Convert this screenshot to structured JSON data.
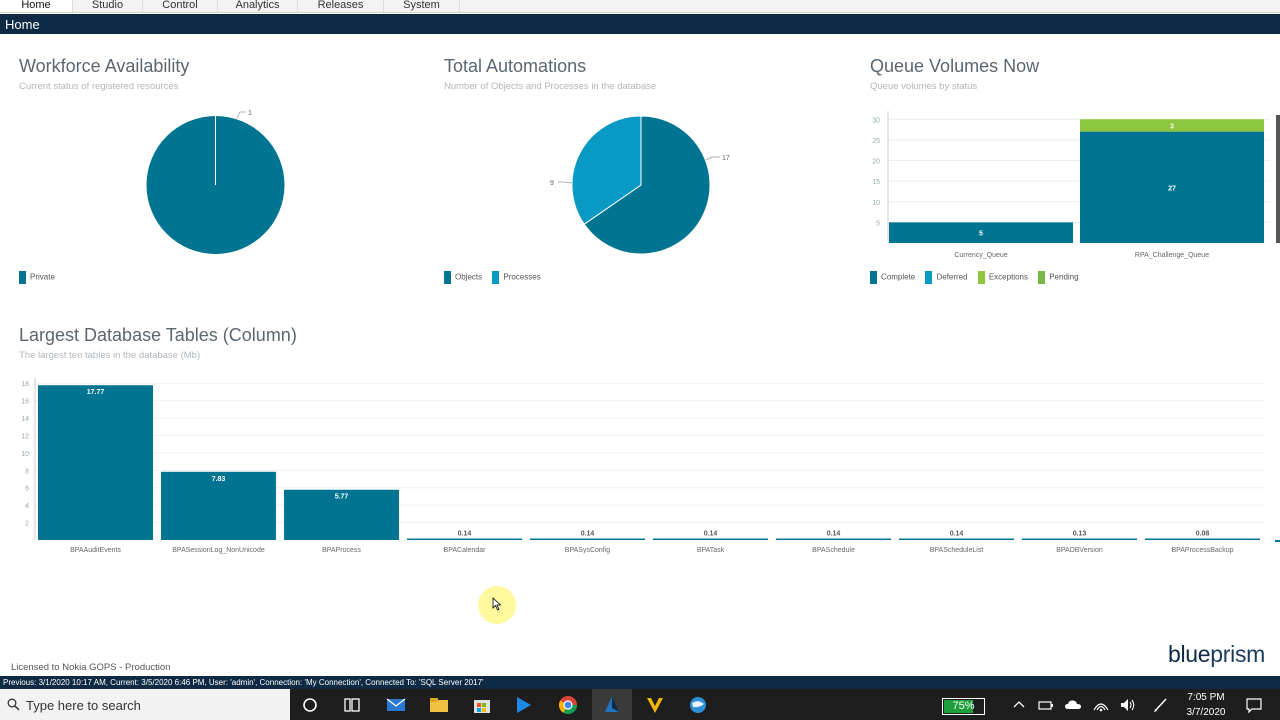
{
  "tabs": [
    {
      "label": "Home",
      "active": true
    },
    {
      "label": "Studio",
      "active": false
    },
    {
      "label": "Control",
      "active": false
    },
    {
      "label": "Analytics",
      "active": false
    },
    {
      "label": "Releases",
      "active": false
    },
    {
      "label": "System",
      "active": false
    }
  ],
  "header": {
    "title": "Home"
  },
  "colors": {
    "primary": "#007490",
    "light_blue": "#0899c5",
    "green": "#8dc63f",
    "header": "#0f2a44"
  },
  "panels": {
    "workforce": {
      "title": "Workforce Availability",
      "subtitle": "Current status of registered resources",
      "legend": [
        "Private"
      ]
    },
    "automations": {
      "title": "Total Automations",
      "subtitle": "Number of Objects and Processes in the database",
      "legend": [
        "Objects",
        "Processes"
      ]
    },
    "queues": {
      "title": "Queue Volumes Now",
      "subtitle": "Queue volumes by status",
      "legend": [
        "Complete",
        "Deferred",
        "Exceptions",
        "Pending"
      ]
    },
    "tables": {
      "title": "Largest Database Tables (Column)",
      "subtitle": "The largest ten tables in the database (Mb)"
    }
  },
  "chart_data": [
    {
      "type": "pie",
      "title": "Workforce Availability",
      "categories": [
        "Private"
      ],
      "values": [
        1
      ],
      "data_labels": [
        "1"
      ]
    },
    {
      "type": "pie",
      "title": "Total Automations",
      "categories": [
        "Objects",
        "Processes"
      ],
      "values": [
        17,
        9
      ],
      "data_labels": [
        "17",
        "9"
      ]
    },
    {
      "type": "bar",
      "title": "Queue Volumes Now",
      "stacked": true,
      "categories": [
        "Currency_Queue",
        "RPA_Challenge_Queue"
      ],
      "series": [
        {
          "name": "Complete",
          "values": [
            5,
            27
          ],
          "color": "#007490"
        },
        {
          "name": "Exceptions",
          "values": [
            0,
            3
          ],
          "color": "#8dc63f"
        }
      ],
      "yticks": [
        5,
        10,
        15,
        20,
        25,
        30
      ],
      "ylim": [
        0,
        32
      ]
    },
    {
      "type": "bar",
      "title": "Largest Database Tables (Column)",
      "categories": [
        "BPAAuditEvents",
        "BPASessionLog_NonUnicode",
        "BPAProcess",
        "BPACalendar",
        "BPASysConfig",
        "BPATask",
        "BPASchedule",
        "BPAScheduleList",
        "BPADBVersion",
        "BPAProcessBackup"
      ],
      "values": [
        17.77,
        7.83,
        5.77,
        0.14,
        0.14,
        0.14,
        0.14,
        0.14,
        0.13,
        0.08
      ],
      "data_labels": [
        "17.77",
        "7.83",
        "5.77",
        "0.14",
        "0.14",
        "0.14",
        "0.14",
        "0.14",
        "0.13",
        "0.08"
      ],
      "yticks": [
        2,
        4,
        6,
        8,
        10,
        12,
        14,
        16,
        18
      ],
      "ylim": [
        0,
        18.6
      ]
    }
  ],
  "footer": {
    "license": "Licensed to Nokia GOPS - Production",
    "logo_left": "blue",
    "logo_right": "prism",
    "status": "Previous: 3/1/2020 10:17 AM, Current: 3/5/2020 6:46 PM, User: 'admin', Connection: 'My Connection', Connected To: 'SQL Server 2017'"
  },
  "taskbar": {
    "search_placeholder": "Type here to search",
    "battery": "75%",
    "battery_level": 0.75,
    "time": "7:05 PM",
    "date": "3/7/2020"
  }
}
